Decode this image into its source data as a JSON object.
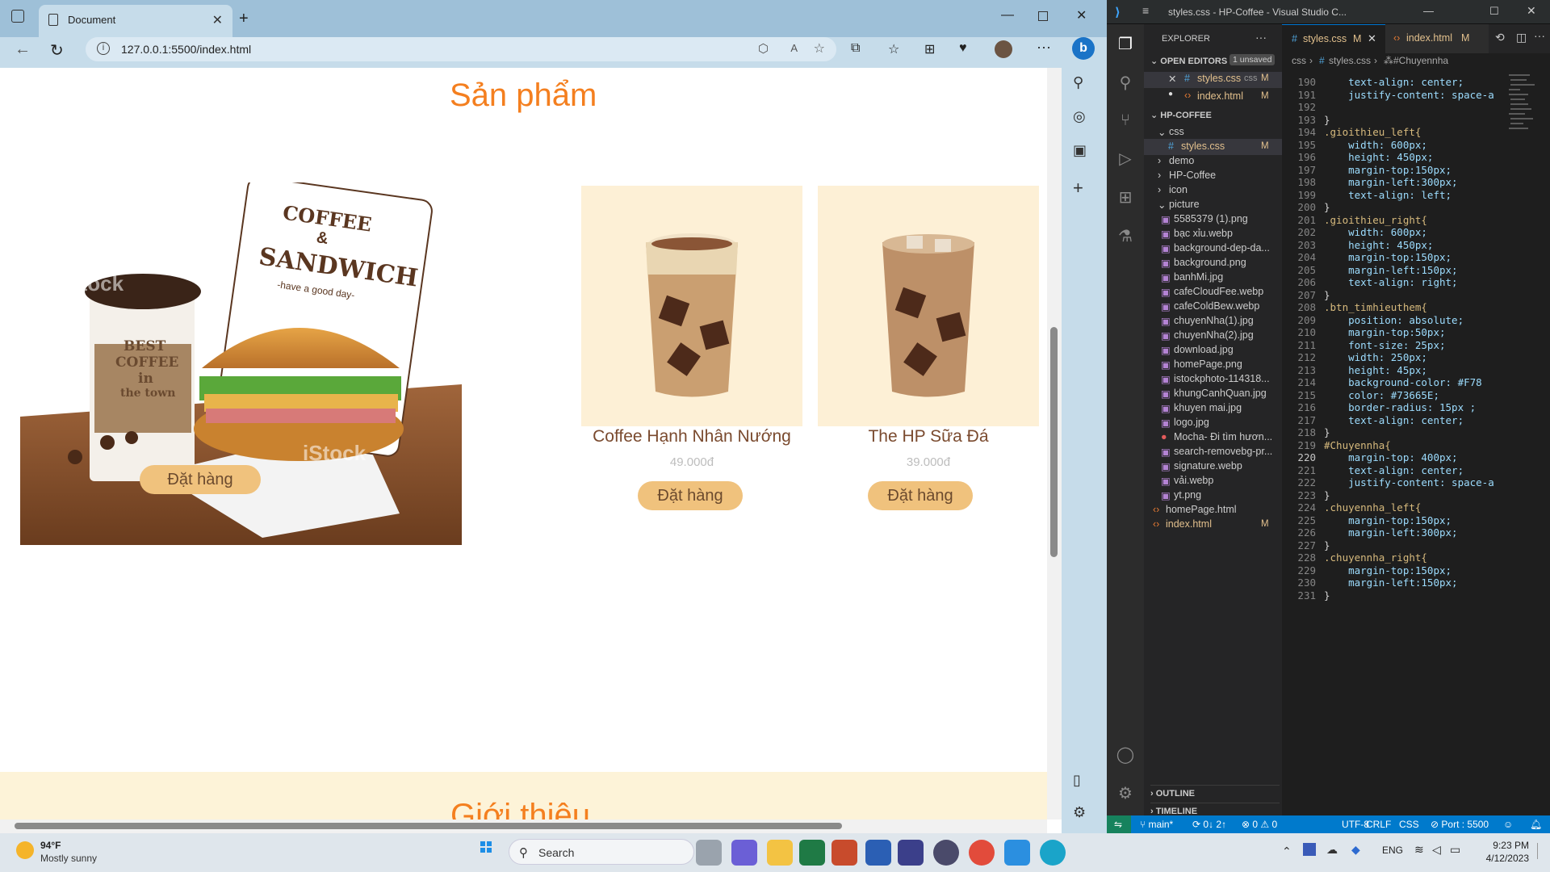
{
  "browser": {
    "tab_title": "Document",
    "url": "127.0.0.1:5500/index.html",
    "page": {
      "section_title": "Sản phẩm",
      "promo_button": "Đặt hàng",
      "products": [
        {
          "name": "Coffee Hạnh Nhân Nướng",
          "price": "49.000đ",
          "button": "Đặt hàng"
        },
        {
          "name": "The HP Sữa Đá",
          "price": "39.000đ",
          "button": "Đặt hàng"
        }
      ],
      "next_section_title": "Giới thiệu",
      "banner": {
        "line1": "COFFEE",
        "line2": "&",
        "line3": "SANDWICH",
        "line4": "-have a good day-",
        "cup_text1": "BEST",
        "cup_text2": "COFFEE",
        "cup_text3": "in",
        "cup_text4": "the town",
        "watermark": "iStock"
      }
    }
  },
  "vscode": {
    "title": "styles.css - HP-Coffee - Visual Studio C...",
    "explorer_label": "EXPLORER",
    "open_editors_label": "OPEN EDITORS",
    "unsaved_badge": "1 unsaved",
    "open_editors": [
      {
        "name": "styles.css",
        "hint": "css",
        "status": "M"
      },
      {
        "name": "index.html",
        "hint": "",
        "status": "M"
      }
    ],
    "project": "HP-COFFEE",
    "tree": [
      {
        "name": "css",
        "kind": "folder-open",
        "status": ""
      },
      {
        "name": "styles.css",
        "kind": "css",
        "status": "M"
      },
      {
        "name": "demo",
        "kind": "folder",
        "status": ""
      },
      {
        "name": "HP-Coffee",
        "kind": "folder",
        "status": ""
      },
      {
        "name": "icon",
        "kind": "folder",
        "status": ""
      },
      {
        "name": "picture",
        "kind": "folder-open",
        "status": ""
      },
      {
        "name": "5585379 (1).png",
        "kind": "image",
        "status": ""
      },
      {
        "name": "bạc xỉu.webp",
        "kind": "image",
        "status": ""
      },
      {
        "name": "background-dep-da...",
        "kind": "image",
        "status": ""
      },
      {
        "name": "background.png",
        "kind": "image",
        "status": ""
      },
      {
        "name": "banhMi.jpg",
        "kind": "image",
        "status": ""
      },
      {
        "name": "cafeCloudFee.webp",
        "kind": "image",
        "status": ""
      },
      {
        "name": "cafeColdBew.webp",
        "kind": "image",
        "status": ""
      },
      {
        "name": "chuyenNha(1).jpg",
        "kind": "image",
        "status": ""
      },
      {
        "name": "chuyenNha(2).jpg",
        "kind": "image",
        "status": ""
      },
      {
        "name": "download.jpg",
        "kind": "image",
        "status": ""
      },
      {
        "name": "homePage.png",
        "kind": "image",
        "status": ""
      },
      {
        "name": "istockphoto-114318...",
        "kind": "image",
        "status": ""
      },
      {
        "name": "khungCanhQuan.jpg",
        "kind": "image",
        "status": ""
      },
      {
        "name": "khuyen mai.jpg",
        "kind": "image",
        "status": ""
      },
      {
        "name": "logo.jpg",
        "kind": "image",
        "status": ""
      },
      {
        "name": "Mocha- Đi tìm hươn...",
        "kind": "video",
        "status": ""
      },
      {
        "name": "search-removebg-pr...",
        "kind": "image",
        "status": ""
      },
      {
        "name": "signature.webp",
        "kind": "image",
        "status": ""
      },
      {
        "name": "vải.webp",
        "kind": "image",
        "status": ""
      },
      {
        "name": "yt.png",
        "kind": "image",
        "status": ""
      },
      {
        "name": "homePage.html",
        "kind": "html",
        "status": ""
      },
      {
        "name": "index.html",
        "kind": "html",
        "status": "M"
      }
    ],
    "outline_label": "OUTLINE",
    "timeline_label": "TIMELINE",
    "editor_tabs": [
      {
        "name": "styles.css",
        "status": "M"
      },
      {
        "name": "index.html",
        "status": "M"
      }
    ],
    "breadcrumb": [
      "css",
      "styles.css",
      "#Chuyennha"
    ],
    "code": [
      {
        "n": "190",
        "t": "    text-align: center;"
      },
      {
        "n": "191",
        "t": "    justify-content: space-a"
      },
      {
        "n": "192",
        "t": ""
      },
      {
        "n": "193",
        "t": "}"
      },
      {
        "n": "194",
        "t": ".gioithieu_left{"
      },
      {
        "n": "195",
        "t": "    width: 600px;"
      },
      {
        "n": "196",
        "t": "    height: 450px;"
      },
      {
        "n": "197",
        "t": "    margin-top:150px;"
      },
      {
        "n": "198",
        "t": "    margin-left:300px;"
      },
      {
        "n": "199",
        "t": "    text-align: left;"
      },
      {
        "n": "200",
        "t": "}"
      },
      {
        "n": "201",
        "t": ".gioithieu_right{"
      },
      {
        "n": "202",
        "t": "    width: 600px;"
      },
      {
        "n": "203",
        "t": "    height: 450px;"
      },
      {
        "n": "204",
        "t": "    margin-top:150px;"
      },
      {
        "n": "205",
        "t": "    margin-left:150px;"
      },
      {
        "n": "206",
        "t": "    text-align: right;"
      },
      {
        "n": "207",
        "t": "}"
      },
      {
        "n": "208",
        "t": ".btn_timhieuthem{"
      },
      {
        "n": "209",
        "t": "    position: absolute;"
      },
      {
        "n": "210",
        "t": "    margin-top:50px;"
      },
      {
        "n": "211",
        "t": "    font-size: 25px;"
      },
      {
        "n": "212",
        "t": "    width: 250px;"
      },
      {
        "n": "213",
        "t": "    height: 45px;"
      },
      {
        "n": "214",
        "t": "    background-color: #F78"
      },
      {
        "n": "215",
        "t": "    color: #73665E;"
      },
      {
        "n": "216",
        "t": "    border-radius: 15px ;"
      },
      {
        "n": "217",
        "t": "    text-align: center;"
      },
      {
        "n": "218",
        "t": "}"
      },
      {
        "n": "219",
        "t": "#Chuyennha{"
      },
      {
        "n": "220",
        "t": "    margin-top: 400px;"
      },
      {
        "n": "221",
        "t": "    text-align: center;"
      },
      {
        "n": "222",
        "t": "    justify-content: space-a"
      },
      {
        "n": "223",
        "t": "}"
      },
      {
        "n": "224",
        "t": ".chuyennha_left{"
      },
      {
        "n": "225",
        "t": "    margin-top:150px;"
      },
      {
        "n": "226",
        "t": "    margin-left:300px;"
      },
      {
        "n": "227",
        "t": "}"
      },
      {
        "n": "228",
        "t": ".chuyennha_right{"
      },
      {
        "n": "229",
        "t": "    margin-top:150px;"
      },
      {
        "n": "230",
        "t": "    margin-left:150px;"
      },
      {
        "n": "231",
        "t": "}"
      }
    ],
    "status": {
      "branch": "main*",
      "sync": "0↓ 2↑",
      "problems": "0 ⚠ 0",
      "encoding": "UTF-8",
      "eol": "CRLF",
      "lang": "CSS",
      "port": "Port : 5500"
    }
  },
  "taskbar": {
    "weather_temp": "94°F",
    "weather_desc": "Mostly sunny",
    "search": "Search",
    "lang": "ENG",
    "time": "9:23 PM",
    "date": "4/12/2023"
  },
  "colors": {
    "accent_title": "#f47f1f",
    "button_bg": "#f0c27d",
    "vscode_status": "#007acc",
    "bg_color_swatch": "#F78",
    "fg_color_swatch": "#73665E"
  }
}
